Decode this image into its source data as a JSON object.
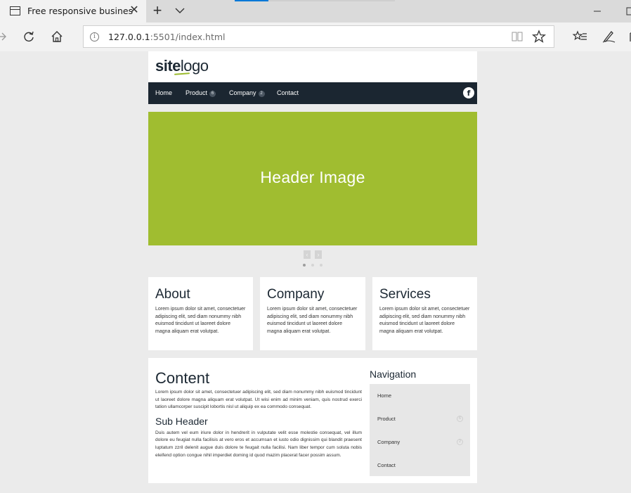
{
  "browser": {
    "tab_title": "Free responsive busines",
    "url_host": "127.0.0.1",
    "url_path": ":5501/index.html"
  },
  "site": {
    "logo_bold": "site",
    "logo_light": "logo",
    "nav": [
      {
        "label": "Home",
        "badge": null
      },
      {
        "label": "Product",
        "badge": "6"
      },
      {
        "label": "Company",
        "badge": "2"
      },
      {
        "label": "Contact",
        "badge": null
      }
    ],
    "social": "f",
    "hero_text": "Header Image",
    "slider_prev": "‹",
    "slider_next": "›",
    "boxes": [
      {
        "title": "About",
        "text": "Lorem ipsum dolor sit amet, consectetuer adipiscing elit, sed diam nonummy nibh euismod tincidunt ut laoreet dolore magna aliquam erat volutpat."
      },
      {
        "title": "Company",
        "text": "Lorem ipsum dolor sit amet, consectetuer adipiscing elit, sed diam nonummy nibh euismod tincidunt ut laoreet dolore magna aliquam erat volutpat."
      },
      {
        "title": "Services",
        "text": "Lorem ipsum dolor sit amet, consectetuer adipiscing elit, sed diam nonummy nibh euismod tincidunt ut laoreet dolore magna aliquam erat volutpat."
      }
    ],
    "content": {
      "title": "Content",
      "para1": "Lorem ipsum dolor sit amet, consectetuer adipiscing elit, sed diam nonummy nibh euismod tincidunt ut laoreet dolore magna aliquam erat volutpat. Ut wisi enim ad minim veniam, quis nostrud exerci tation ullamcorper suscipit lobortis nisl ut aliquip ex ea commodo consequat.",
      "subheader": "Sub Header",
      "para2": "Duis autem vel eum iriure dolor in hendrerit in vulputate velit esse molestie consequat, vel illum dolore eu feugiat nulla facilisis at vero eros et accumsan et iusto odio dignissim qui blandit praesent luptatum zzril delenit augue duis dolore te feugait nulla facilisi. Nam liber tempor cum soluta nobis eleifend option congue nihil imperdiet doming id quod mazim placerat facer possim assum."
    },
    "sidenav": {
      "title": "Navigation",
      "items": [
        {
          "label": "Home",
          "badge": null
        },
        {
          "label": "Product",
          "badge": "6"
        },
        {
          "label": "Company",
          "badge": "2"
        },
        {
          "label": "Contact",
          "badge": null
        }
      ]
    }
  },
  "colors": {
    "brand_green": "#a0bd30",
    "navbar": "#1b2631"
  }
}
